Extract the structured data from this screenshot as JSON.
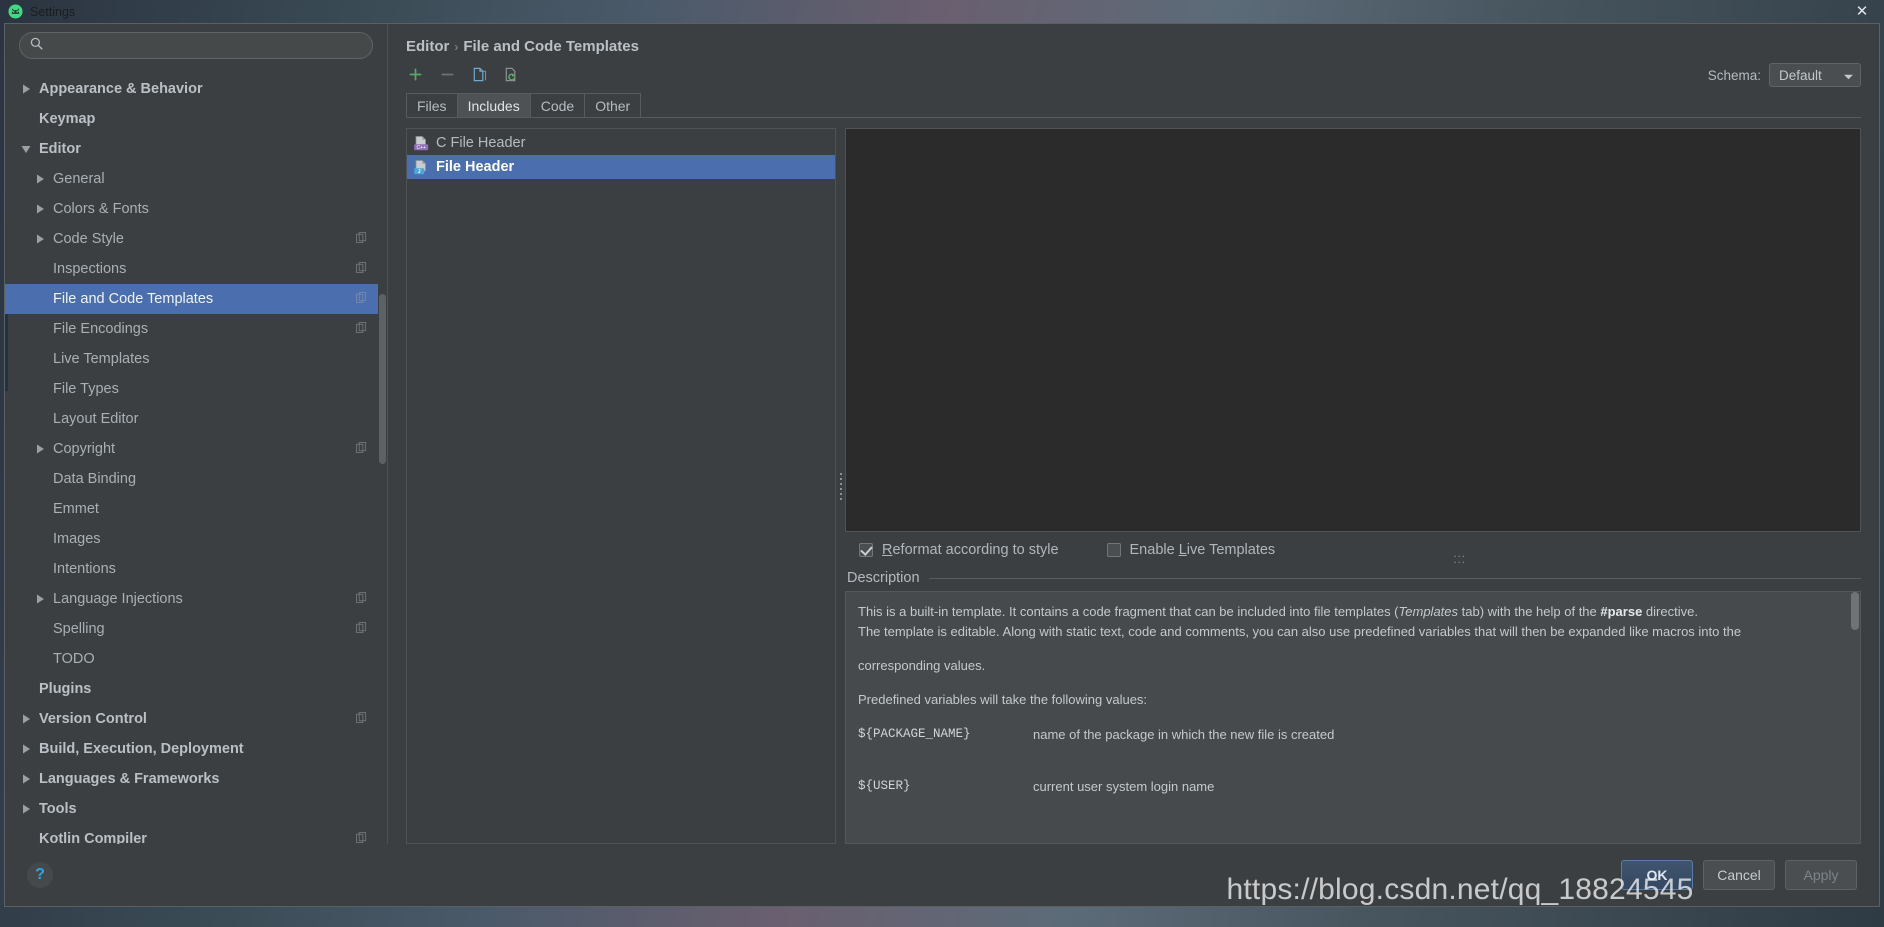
{
  "window": {
    "title": "Settings",
    "app_icon": "android-studio-icon",
    "close_label": "✕"
  },
  "search": {
    "value": "",
    "placeholder": "",
    "icon": "search-icon"
  },
  "sidebar": {
    "items": [
      {
        "label": "Appearance & Behavior",
        "level": 0,
        "arrow": "collapsed",
        "bold": true,
        "selected": false,
        "badge": false
      },
      {
        "label": "Keymap",
        "level": 0,
        "arrow": "none",
        "bold": true,
        "selected": false,
        "badge": false
      },
      {
        "label": "Editor",
        "level": 0,
        "arrow": "expanded",
        "bold": true,
        "selected": false,
        "badge": false
      },
      {
        "label": "General",
        "level": 1,
        "arrow": "collapsed",
        "bold": false,
        "selected": false,
        "badge": false
      },
      {
        "label": "Colors & Fonts",
        "level": 1,
        "arrow": "collapsed",
        "bold": false,
        "selected": false,
        "badge": false
      },
      {
        "label": "Code Style",
        "level": 1,
        "arrow": "collapsed",
        "bold": false,
        "selected": false,
        "badge": true
      },
      {
        "label": "Inspections",
        "level": 1,
        "arrow": "none",
        "bold": false,
        "selected": false,
        "badge": true
      },
      {
        "label": "File and Code Templates",
        "level": 1,
        "arrow": "none",
        "bold": false,
        "selected": true,
        "badge": true
      },
      {
        "label": "File Encodings",
        "level": 1,
        "arrow": "none",
        "bold": false,
        "selected": false,
        "badge": true
      },
      {
        "label": "Live Templates",
        "level": 1,
        "arrow": "none",
        "bold": false,
        "selected": false,
        "badge": false
      },
      {
        "label": "File Types",
        "level": 1,
        "arrow": "none",
        "bold": false,
        "selected": false,
        "badge": false
      },
      {
        "label": "Layout Editor",
        "level": 1,
        "arrow": "none",
        "bold": false,
        "selected": false,
        "badge": false
      },
      {
        "label": "Copyright",
        "level": 1,
        "arrow": "collapsed",
        "bold": false,
        "selected": false,
        "badge": true
      },
      {
        "label": "Data Binding",
        "level": 1,
        "arrow": "none",
        "bold": false,
        "selected": false,
        "badge": false
      },
      {
        "label": "Emmet",
        "level": 1,
        "arrow": "none",
        "bold": false,
        "selected": false,
        "badge": false
      },
      {
        "label": "Images",
        "level": 1,
        "arrow": "none",
        "bold": false,
        "selected": false,
        "badge": false
      },
      {
        "label": "Intentions",
        "level": 1,
        "arrow": "none",
        "bold": false,
        "selected": false,
        "badge": false
      },
      {
        "label": "Language Injections",
        "level": 1,
        "arrow": "collapsed",
        "bold": false,
        "selected": false,
        "badge": true
      },
      {
        "label": "Spelling",
        "level": 1,
        "arrow": "none",
        "bold": false,
        "selected": false,
        "badge": true
      },
      {
        "label": "TODO",
        "level": 1,
        "arrow": "none",
        "bold": false,
        "selected": false,
        "badge": false
      },
      {
        "label": "Plugins",
        "level": 0,
        "arrow": "none",
        "bold": true,
        "selected": false,
        "badge": false
      },
      {
        "label": "Version Control",
        "level": 0,
        "arrow": "collapsed",
        "bold": true,
        "selected": false,
        "badge": true
      },
      {
        "label": "Build, Execution, Deployment",
        "level": 0,
        "arrow": "collapsed",
        "bold": true,
        "selected": false,
        "badge": false
      },
      {
        "label": "Languages & Frameworks",
        "level": 0,
        "arrow": "collapsed",
        "bold": true,
        "selected": false,
        "badge": false
      },
      {
        "label": "Tools",
        "level": 0,
        "arrow": "collapsed",
        "bold": true,
        "selected": false,
        "badge": false
      },
      {
        "label": "Kotlin Compiler",
        "level": 0,
        "arrow": "none",
        "bold": true,
        "selected": false,
        "badge": true
      }
    ]
  },
  "breadcrumb": {
    "parent": "Editor",
    "separator": "›",
    "current": "File and Code Templates"
  },
  "toolbar": {
    "add_icon": "plus-icon",
    "remove_icon": "minus-icon",
    "copy_icon": "copy-template-icon",
    "reset_icon": "reset-to-default-icon"
  },
  "schema": {
    "label": "Schema:",
    "value": "Default",
    "chevron_icon": "chevron-down-icon"
  },
  "tabs": [
    {
      "label": "Files",
      "active": false
    },
    {
      "label": "Includes",
      "active": true
    },
    {
      "label": "Code",
      "active": false
    },
    {
      "label": "Other",
      "active": false
    }
  ],
  "templates": [
    {
      "label": "C File Header",
      "icon": "cpp-file-template-icon",
      "badge_text": "C++",
      "badge_color": "#8f6fb5",
      "selected": false
    },
    {
      "label": "File Header",
      "icon": "java-file-template-icon",
      "badge_text": "J",
      "badge_color": "#4da6d9",
      "selected": true
    }
  ],
  "editor": {
    "content": "",
    "background": "#2b2b2b"
  },
  "options": [
    {
      "label": "Reformat according to style",
      "checked": true,
      "mnemonic": "R"
    },
    {
      "label": "Enable Live Templates",
      "checked": false,
      "mnemonic": "L"
    }
  ],
  "description": {
    "title": "Description",
    "paragraph_1_a": "This is a built-in template. It contains a code fragment that can be included into file templates (",
    "paragraph_1_em": "Templates",
    "paragraph_1_b": " tab) with the help of the ",
    "paragraph_1_strong": "#parse",
    "paragraph_1_c": " directive.",
    "paragraph_2": "The template is editable. Along with static text, code and comments, you can also use predefined variables that will then be expanded like macros into the",
    "paragraph_3": "corresponding values.",
    "variables_intro": "Predefined variables will take the following values:",
    "variables": [
      {
        "name": "${PACKAGE_NAME}",
        "desc": "name of the package in which the new file is created"
      },
      {
        "name": "${USER}",
        "desc": "current user system login name"
      }
    ]
  },
  "footer": {
    "help_icon": "help-question-icon",
    "buttons": [
      {
        "label": "OK",
        "style": "primary",
        "enabled": true
      },
      {
        "label": "Cancel",
        "style": "default",
        "enabled": true
      },
      {
        "label": "Apply",
        "style": "disabled",
        "enabled": false
      }
    ]
  },
  "watermark": {
    "text": "https://blog.csdn.net/qq_18824545"
  },
  "colors": {
    "selection_blue": "#4b6eaf",
    "panel_bg": "#3c3f41",
    "editor_bg": "#2b2b2b",
    "desc_bg": "#464a4c",
    "accent_green": "#59a869",
    "help_blue": "#30a6e0"
  }
}
